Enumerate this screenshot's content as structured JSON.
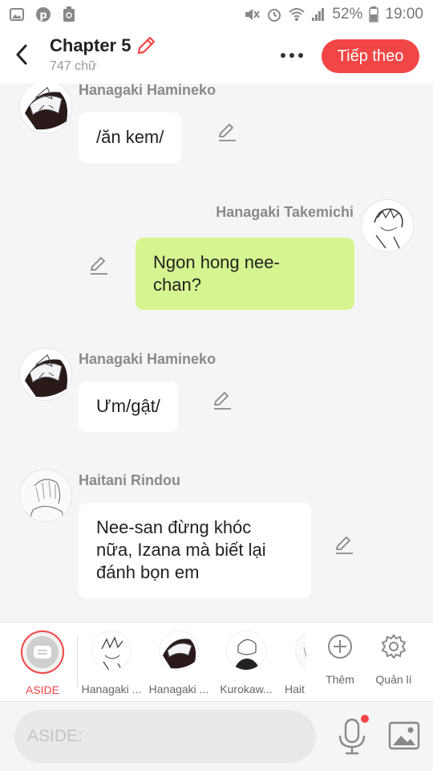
{
  "status_bar": {
    "battery": "52%",
    "time": "19:00"
  },
  "header": {
    "title": "Chapter 5",
    "word_count": "747 chữ",
    "next_label": "Tiếp theo"
  },
  "messages": [
    {
      "sender": "Hanagaki Hamineko",
      "text": "/ăn kem/"
    },
    {
      "sender": "Hanagaki Takemichi",
      "text": "Ngon hong nee-\nchan?"
    },
    {
      "sender": "Hanagaki Hamineko",
      "text": "Ưm/gật/"
    },
    {
      "sender": "Haitani Rindou",
      "text": "Nee-san đừng khóc\nnữa, Izana mà biết lại\nđánh bọn em"
    }
  ],
  "char_bar": {
    "aside_label": "ASIDE",
    "characters": [
      "Hanagaki ...",
      "Hanagaki ...",
      "Kurokaw...",
      "Hait"
    ],
    "add_label": "Thêm",
    "manage_label": "Quản lí"
  },
  "input": {
    "placeholder": "ASIDE:"
  },
  "colors": {
    "accent": "#f24545",
    "bubble_me": "#d6f590",
    "bubble_other": "#ffffff"
  }
}
